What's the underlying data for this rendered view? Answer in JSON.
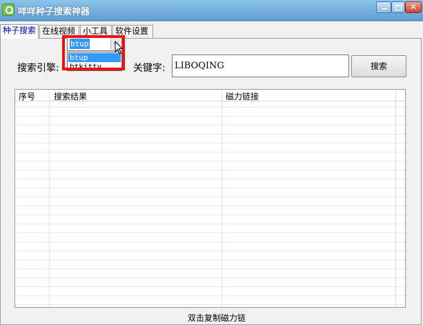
{
  "window": {
    "title": "咩咩种子搜索神器",
    "controls": {
      "minimize": "minimize-icon",
      "maximize": "maximize-icon",
      "close": "close-icon",
      "close_glyph": "✕"
    }
  },
  "tabs": [
    {
      "label": "种子搜索",
      "active": true
    },
    {
      "label": "在线视频",
      "active": false
    },
    {
      "label": "小工具",
      "active": false
    },
    {
      "label": "软件设置",
      "active": false
    }
  ],
  "search": {
    "engine_label": "搜索引擎:",
    "engine_value": "btup",
    "engine_options": [
      "btup",
      "btkitty"
    ],
    "keyword_label": "关键字:",
    "keyword_value": "LIBOQING",
    "search_button": "搜索"
  },
  "results": {
    "columns": [
      "序号",
      "搜索结果",
      "磁力链接"
    ],
    "rows": []
  },
  "status": {
    "hint": "双击复制磁力链"
  },
  "colors": {
    "highlight": "#ee1111",
    "selection": "#3399ff",
    "titlebar": "#6aa8d6"
  }
}
